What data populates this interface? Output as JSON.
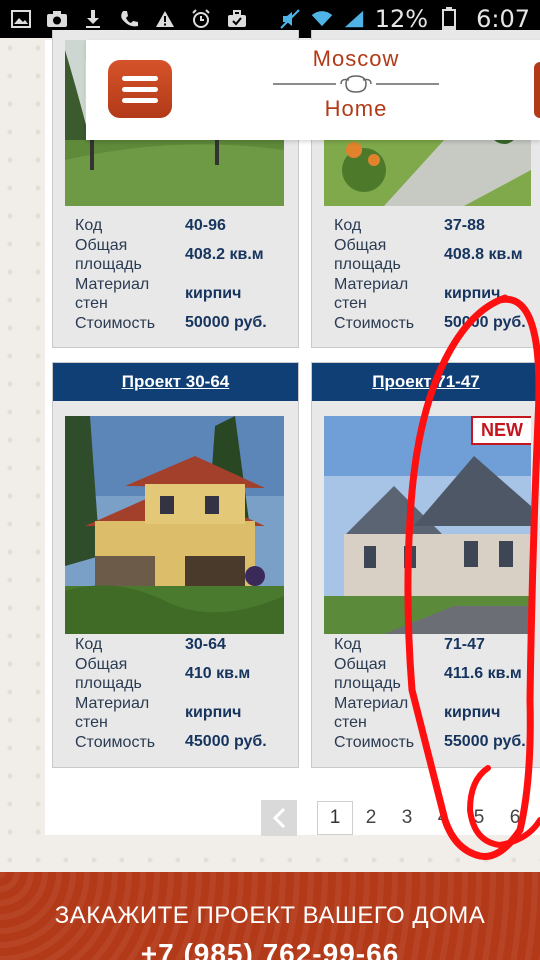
{
  "status_bar": {
    "battery": "12%",
    "time": "6:07",
    "icons": [
      "image-icon",
      "camera-icon",
      "download-icon",
      "phone-icon",
      "warning-icon",
      "alarm-icon",
      "briefcase-icon",
      "mute-icon",
      "wifi-icon",
      "signal-icon",
      "battery-icon"
    ]
  },
  "header": {
    "logo_line1": "Moscow",
    "logo_line2": "Home",
    "brand_color": "#b23a18"
  },
  "projects": [
    {
      "title": "",
      "code": "40-96",
      "area": "408.2 кв.м",
      "material": "кирпич",
      "price": "50000 руб.",
      "is_new": false
    },
    {
      "title": "",
      "code": "37-88",
      "area": "408.8 кв.м",
      "material": "кирпич",
      "price": "50000 руб.",
      "is_new": false
    },
    {
      "title": "Проект 30-64",
      "code": "30-64",
      "area": "410 кв.м",
      "material": "кирпич",
      "price": "45000 руб.",
      "is_new": false
    },
    {
      "title": "Проект 71-47",
      "code": "71-47",
      "area": "411.6 кв.м",
      "material": "кирпич",
      "price": "55000 руб.",
      "is_new": true,
      "badge": "NEW"
    }
  ],
  "labels": {
    "code": "Код",
    "area_1": "Общая",
    "area_2": "площадь",
    "material_1": "Материал",
    "material_2": "стен",
    "price": "Стоимость"
  },
  "pagination": {
    "pages": [
      "1",
      "2",
      "3",
      "4",
      "5",
      "6"
    ],
    "current": "1"
  },
  "footer": {
    "cta": "ЗАКАЖИТЕ ПРОЕКТ ВАШЕГО ДОМА",
    "phone": "+7 (985) 762-99-66"
  }
}
